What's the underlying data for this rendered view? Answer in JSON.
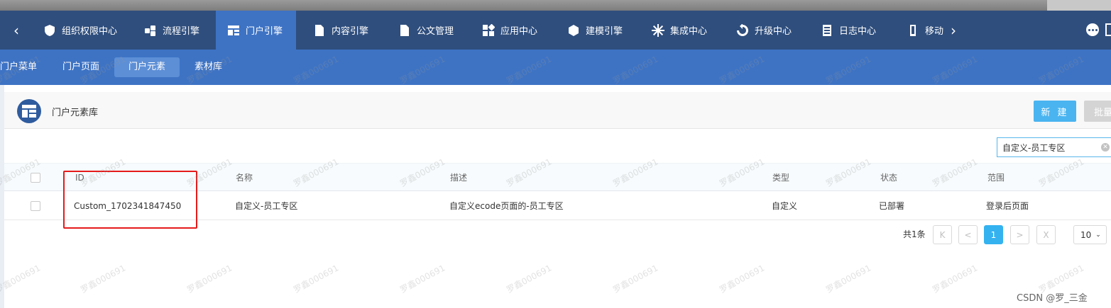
{
  "nav": {
    "items": [
      {
        "label": "组织权限中心",
        "icon": "shield-icon"
      },
      {
        "label": "流程引擎",
        "icon": "flow-icon"
      },
      {
        "label": "门户引擎",
        "icon": "portal-icon"
      },
      {
        "label": "内容引擎",
        "icon": "document-icon"
      },
      {
        "label": "公文管理",
        "icon": "file-icon"
      },
      {
        "label": "应用中心",
        "icon": "apps-icon"
      },
      {
        "label": "建模引擎",
        "icon": "cube-icon"
      },
      {
        "label": "集成中心",
        "icon": "snowflake-icon"
      },
      {
        "label": "升级中心",
        "icon": "refresh-icon"
      },
      {
        "label": "日志中心",
        "icon": "log-icon"
      },
      {
        "label": "移动",
        "icon": "mobile-icon"
      }
    ],
    "active_index": 2
  },
  "subnav": {
    "items": [
      "门户菜单",
      "门户页面",
      "门户元素",
      "素材库"
    ],
    "active_index": 2
  },
  "page": {
    "title": "门户元素库",
    "new_button": "新 建",
    "batch_button": "批量",
    "search_value": "自定义-员工专区"
  },
  "table": {
    "columns": [
      "ID",
      "名称",
      "描述",
      "类型",
      "状态",
      "范围"
    ],
    "rows": [
      {
        "id": "Custom_1702341847450",
        "name": "自定义-员工专区",
        "desc": "自定义ecode页面的-员工专区",
        "type": "自定义",
        "status": "已部署",
        "scope": "登录后页面"
      }
    ]
  },
  "pagination": {
    "total_label": "共1条",
    "first": "K",
    "prev": "<",
    "current": "1",
    "next": ">",
    "last": "X",
    "page_size": "10"
  },
  "watermark": "罗鑫000691",
  "credit": "CSDN @罗_三金",
  "colors": {
    "nav_bg": "#2f4e7d",
    "subnav_bg": "#3e73c4",
    "primary": "#4ab4f0",
    "highlight_box": "#e51b1b"
  }
}
